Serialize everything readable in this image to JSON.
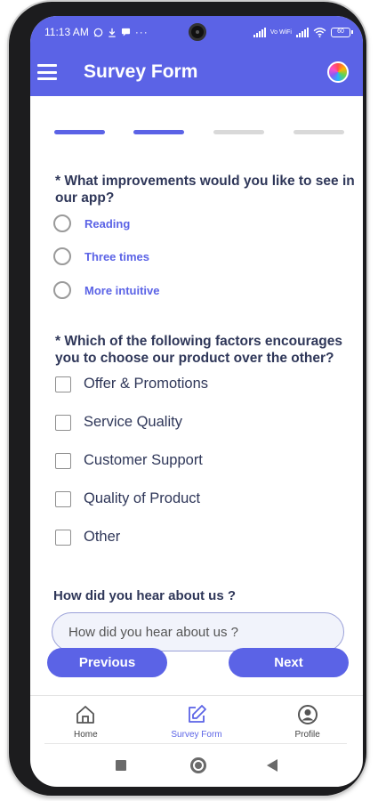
{
  "status_bar": {
    "time": "11:13 AM",
    "icons": [
      "whatsapp-icon",
      "download-icon",
      "message-icon",
      "more-dots-icon"
    ],
    "vowifi": "Vo WiFi",
    "battery": "60"
  },
  "app_bar": {
    "title": "Survey Form",
    "menu_icon": "hamburger-menu-icon",
    "logo_icon": "app-logo-icon"
  },
  "progress": {
    "total_steps": 4,
    "current_step": 2
  },
  "question1": {
    "text": "* What improvements would you like to see in our app?",
    "options": [
      "Reading",
      "Three times",
      "More intuitive"
    ]
  },
  "question2": {
    "text": "* Which of the following factors encourages you to choose our product over the other?",
    "options": [
      "Offer & Promotions",
      "Service Quality",
      "Customer Support",
      "Quality of Product",
      "Other"
    ]
  },
  "question3": {
    "text": "How did you hear about us ?",
    "placeholder": "How did you hear about us ?",
    "value": ""
  },
  "buttons": {
    "previous": "Previous",
    "next": "Next"
  },
  "bottom_nav": {
    "items": [
      {
        "label": "Home",
        "icon": "home-icon"
      },
      {
        "label": "Survey Form",
        "icon": "edit-form-icon"
      },
      {
        "label": "Profile",
        "icon": "profile-icon"
      }
    ],
    "active_index": 1
  },
  "colors": {
    "primary": "#5b63e6",
    "text_dark": "#2f3759",
    "inactive": "#d9d9d9"
  }
}
